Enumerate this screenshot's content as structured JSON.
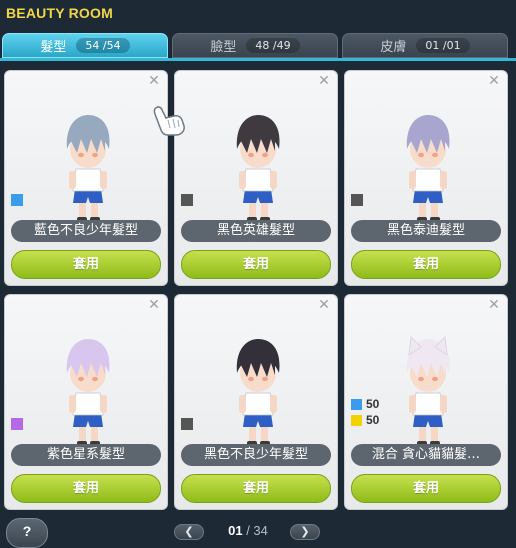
{
  "window": {
    "title": "BEAUTY ROOM"
  },
  "tabs": [
    {
      "label": "髮型",
      "count": "54 /54",
      "active": true
    },
    {
      "label": "臉型",
      "count": "48 /49",
      "active": false
    },
    {
      "label": "皮膚",
      "count": "01 /01",
      "active": false
    }
  ],
  "cards": [
    {
      "name": "藍色不良少年髮型",
      "apply_label": "套用",
      "color": "#3b9bec",
      "hair": "#97a9bf"
    },
    {
      "name": "黑色英雄髮型",
      "apply_label": "套用",
      "color": "#555555",
      "hair": "#3f3a40"
    },
    {
      "name": "黑色泰迪髮型",
      "apply_label": "套用",
      "color": "#555555",
      "hair": "#a8a6cf"
    },
    {
      "name": "紫色星系髮型",
      "apply_label": "套用",
      "color": "#b469e6",
      "hair": "#d9c6ef"
    },
    {
      "name": "黑色不良少年髮型",
      "apply_label": "套用",
      "color": "#555555",
      "hair": "#34303a"
    },
    {
      "name": "混合 貪心貓貓髮…",
      "apply_label": "套用",
      "hair": "#efe8f3",
      "mix": [
        {
          "color": "#3b9bec",
          "percent": "50"
        },
        {
          "color": "#f2d200",
          "percent": "50"
        }
      ]
    }
  ],
  "footer": {
    "help_label": "?",
    "page_current": "01",
    "page_total": "/ 34",
    "prev_icon": "chevron-left-icon",
    "next_icon": "chevron-right-icon"
  }
}
